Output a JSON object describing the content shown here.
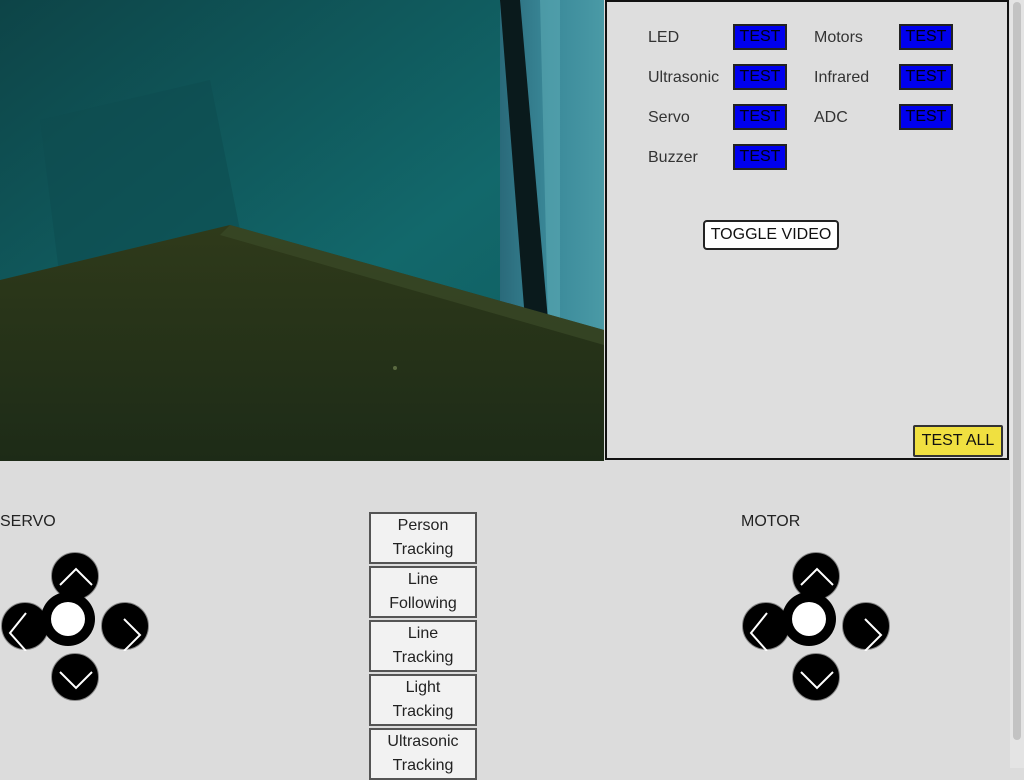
{
  "test_panel": {
    "items": [
      {
        "label": "LED",
        "button": "TEST"
      },
      {
        "label": "Motors",
        "button": "TEST"
      },
      {
        "label": "Ultrasonic",
        "button": "TEST"
      },
      {
        "label": "Infrared",
        "button": "TEST"
      },
      {
        "label": "Servo",
        "button": "TEST"
      },
      {
        "label": "ADC",
        "button": "TEST"
      },
      {
        "label": "Buzzer",
        "button": "TEST"
      }
    ],
    "toggle_video": "TOGGLE VIDEO",
    "test_all": "TEST ALL"
  },
  "servo": {
    "label": "SERVO"
  },
  "motor": {
    "label": "MOTOR"
  },
  "modes": [
    "Person\nTracking",
    "Line\nFollowing",
    "Line\nTracking",
    "Light\nTracking",
    "Ultrasonic\nTracking"
  ],
  "icons": {
    "up": "chevron-up-icon",
    "down": "chevron-down-icon",
    "left": "chevron-left-icon",
    "right": "chevron-right-icon",
    "center": "circle-icon"
  },
  "colors": {
    "test_button": "#0000ee",
    "test_all_button": "#f0e040",
    "background": "#dcdcdc"
  }
}
